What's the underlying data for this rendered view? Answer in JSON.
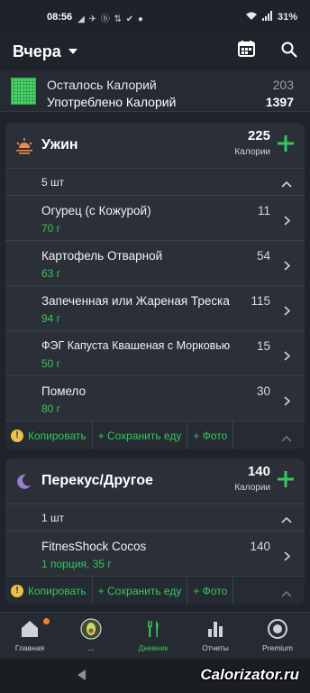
{
  "status": {
    "time": "08:56",
    "icons": "◢ ✈ ⓑ ⇅ ✔ ●",
    "battery": "31%"
  },
  "header": {
    "title": "Вчера"
  },
  "summary": {
    "remaining_label": "Осталось Калорий",
    "remaining_value": "203",
    "consumed_label": "Употреблено Калорий",
    "consumed_value": "1397"
  },
  "dinner": {
    "name": "Ужин",
    "kcal": "225",
    "kcal_label": "Калории",
    "count": "5 шт",
    "items": [
      {
        "name": "Огурец (с Кожурой)",
        "amount": "70 г",
        "kcal": "11"
      },
      {
        "name": "Картофель Отварной",
        "amount": "63 г",
        "kcal": "54"
      },
      {
        "name": "Запеченная или Жареная Треска",
        "amount": "94 г",
        "kcal": "115"
      },
      {
        "name": "ФЭГ Капуста Квашеная с Морковью",
        "amount": "50 г",
        "kcal": "15"
      },
      {
        "name": "Помело",
        "amount": "80 г",
        "kcal": "30"
      }
    ],
    "actions": {
      "copy": "Копировать",
      "save": "+ Сохранить еду",
      "photo": "+ Фото"
    }
  },
  "snack": {
    "name": "Перекус/Другое",
    "kcal": "140",
    "kcal_label": "Калории",
    "count": "1 шт",
    "items": [
      {
        "name": "FitnesShock Cocos",
        "amount": "1 порция, 35 г",
        "kcal": "140"
      }
    ],
    "actions": {
      "copy": "Копировать",
      "save": "+ Сохранить еду",
      "photo": "+ Фото"
    }
  },
  "nav": {
    "home": "Главная",
    "avatar": "...",
    "diary": "Дневник",
    "reports": "Отчеты",
    "premium": "Premium"
  },
  "watermark": "Calorizator.ru",
  "colors": {
    "accent": "#35c75a",
    "background": "#1f242c",
    "card": "#2a2f38"
  }
}
